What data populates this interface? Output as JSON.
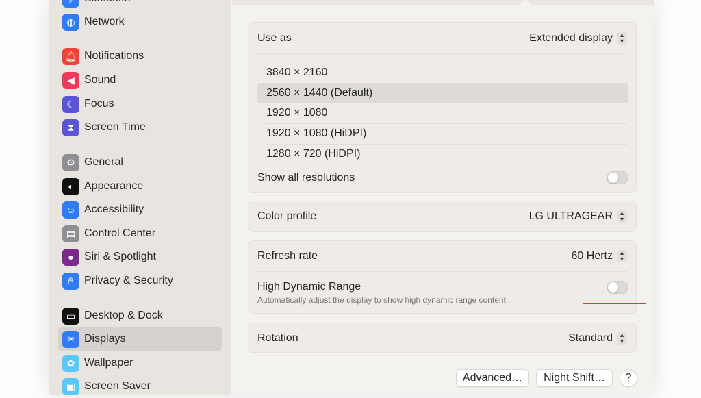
{
  "sidebar": {
    "items": [
      {
        "label": "Bluetooth",
        "icon": "bluetooth-icon",
        "color": "#2f7cf6"
      },
      {
        "label": "Network",
        "icon": "globe-icon",
        "color": "#2f7cf6"
      },
      {
        "label": "Notifications",
        "icon": "bell-icon",
        "color": "#f0443a"
      },
      {
        "label": "Sound",
        "icon": "speaker-icon",
        "color": "#ef3b5a"
      },
      {
        "label": "Focus",
        "icon": "moon-icon",
        "color": "#5b54d6"
      },
      {
        "label": "Screen Time",
        "icon": "hourglass-icon",
        "color": "#5b54d6"
      },
      {
        "label": "General",
        "icon": "gear-icon",
        "color": "#8e8e93"
      },
      {
        "label": "Appearance",
        "icon": "appearance-icon",
        "color": "#111111"
      },
      {
        "label": "Accessibility",
        "icon": "accessibility-icon",
        "color": "#2f7cf6"
      },
      {
        "label": "Control Center",
        "icon": "control-center-icon",
        "color": "#8e8e93"
      },
      {
        "label": "Siri & Spotlight",
        "icon": "siri-icon",
        "color": "#7a2a8a"
      },
      {
        "label": "Privacy & Security",
        "icon": "hand-icon",
        "color": "#2f7cf6"
      },
      {
        "label": "Desktop & Dock",
        "icon": "dock-icon",
        "color": "#111111"
      },
      {
        "label": "Displays",
        "icon": "sun-icon",
        "color": "#2f7cf6"
      },
      {
        "label": "Wallpaper",
        "icon": "flower-icon",
        "color": "#5ac8fa"
      },
      {
        "label": "Screen Saver",
        "icon": "screen-saver-icon",
        "color": "#5ac8fa"
      }
    ],
    "selected": "Displays"
  },
  "main": {
    "use_as": {
      "label": "Use as",
      "value": "Extended display"
    },
    "resolutions": [
      "3840 × 2160",
      "2560 × 1440 (Default)",
      "1920 × 1080",
      "1920 × 1080 (HiDPI)",
      "1280 × 720 (HiDPI)"
    ],
    "selected_resolution": "2560 × 1440 (Default)",
    "show_all": {
      "label": "Show all resolutions",
      "on": false
    },
    "color_profile": {
      "label": "Color profile",
      "value": "LG ULTRAGEAR"
    },
    "refresh_rate": {
      "label": "Refresh rate",
      "value": "60 Hertz"
    },
    "hdr": {
      "label": "High Dynamic Range",
      "description": "Automatically adjust the display to show high dynamic range content.",
      "on": false,
      "highlight_color": "#e0393e"
    },
    "rotation": {
      "label": "Rotation",
      "value": "Standard"
    },
    "buttons": {
      "advanced": "Advanced…",
      "night_shift": "Night Shift…",
      "help": "?"
    }
  }
}
